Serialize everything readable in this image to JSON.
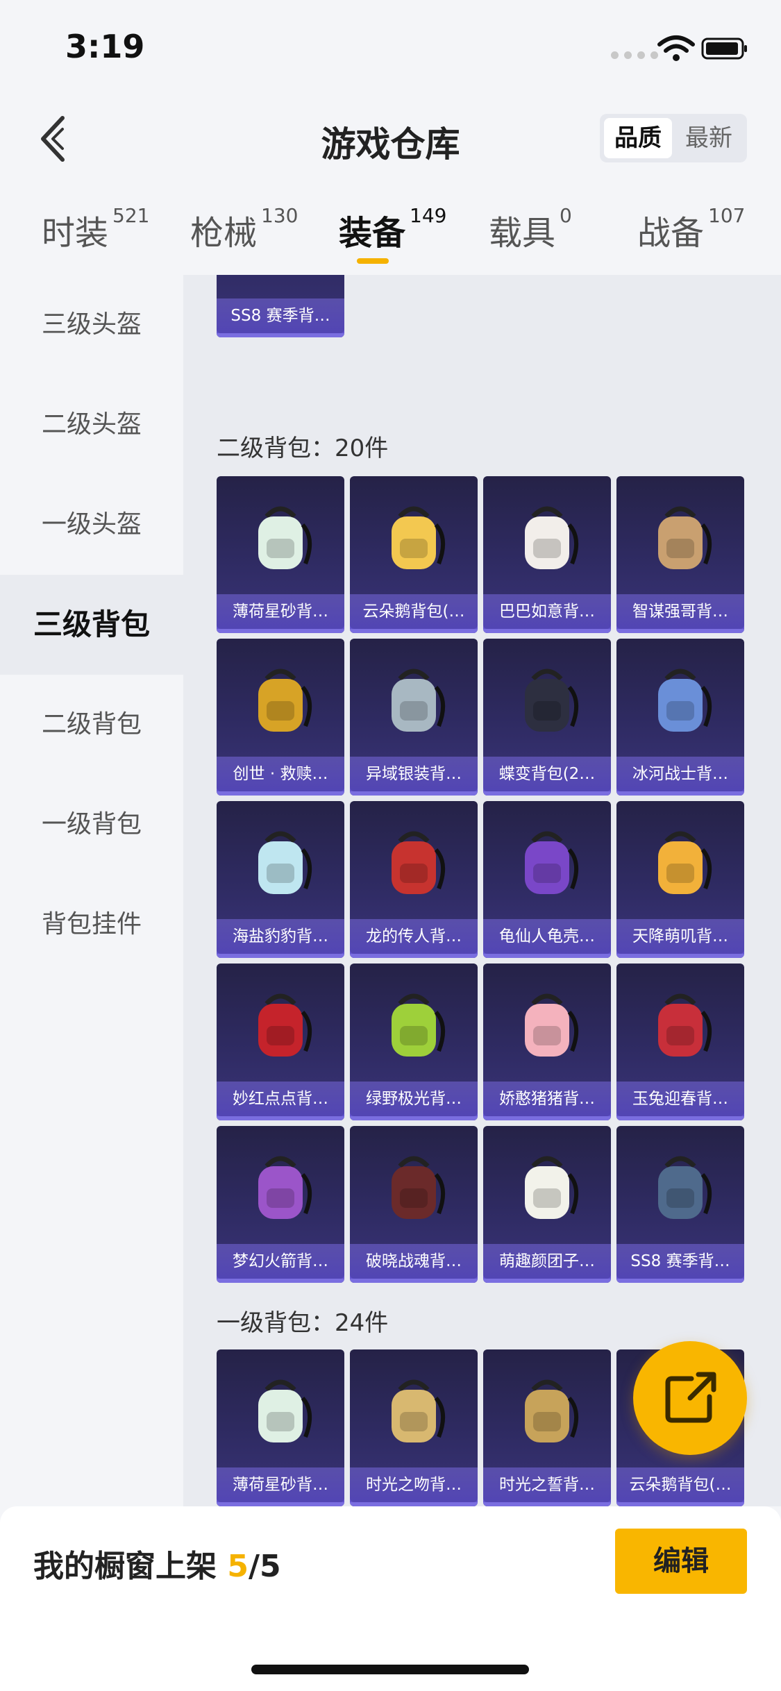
{
  "status_bar": {
    "time": "3:19"
  },
  "header": {
    "title": "游戏仓库",
    "sort_quality": "品质",
    "sort_newest": "最新"
  },
  "tabs": [
    {
      "label": "时装",
      "count": "521"
    },
    {
      "label": "枪械",
      "count": "130"
    },
    {
      "label": "装备",
      "count": "149"
    },
    {
      "label": "载具",
      "count": "0"
    },
    {
      "label": "战备",
      "count": "107"
    }
  ],
  "sidebar": {
    "items": [
      {
        "label": "三级头盔"
      },
      {
        "label": "二级头盔"
      },
      {
        "label": "一级头盔"
      },
      {
        "label": "三级背包"
      },
      {
        "label": "二级背包"
      },
      {
        "label": "一级背包"
      },
      {
        "label": "背包挂件"
      }
    ]
  },
  "sections": [
    {
      "items": [
        {
          "name": "SS8 赛季背…",
          "color": "#3a4a6a"
        }
      ]
    },
    {
      "title": "二级背包：20件",
      "items": [
        {
          "name": "薄荷星砂背…",
          "color": "#dff0e4"
        },
        {
          "name": "云朵鹅背包(…",
          "color": "#f3c850"
        },
        {
          "name": "巴巴如意背…",
          "color": "#f2eeea"
        },
        {
          "name": "智谋强哥背…",
          "color": "#c9a070"
        },
        {
          "name": "创世 · 救赎…",
          "color": "#d7a326"
        },
        {
          "name": "异域银装背…",
          "color": "#a8b8c2"
        },
        {
          "name": "蝶变背包(2…",
          "color": "#2d2f40"
        },
        {
          "name": "冰河战士背…",
          "color": "#6a8fd8"
        },
        {
          "name": "海盐豹豹背…",
          "color": "#bfe6f0"
        },
        {
          "name": "龙的传人背…",
          "color": "#c7332f"
        },
        {
          "name": "龟仙人龟壳…",
          "color": "#7a47c8"
        },
        {
          "name": "天降萌叽背…",
          "color": "#f2b13a"
        },
        {
          "name": "妙红点点背…",
          "color": "#c5232b"
        },
        {
          "name": "绿野极光背…",
          "color": "#9ed03a"
        },
        {
          "name": "娇憨猪猪背…",
          "color": "#f4b2bd"
        },
        {
          "name": "玉兔迎春背…",
          "color": "#c82f3a"
        },
        {
          "name": "梦幻火箭背…",
          "color": "#9b55c9"
        },
        {
          "name": "破晓战魂背…",
          "color": "#6b2a2a"
        },
        {
          "name": "萌趣颜团子…",
          "color": "#f2f2ea"
        },
        {
          "name": "SS8 赛季背…",
          "color": "#4f6a8c"
        }
      ]
    },
    {
      "title": "一级背包：24件",
      "items": [
        {
          "name": "薄荷星砂背…",
          "color": "#dff0e4"
        },
        {
          "name": "时光之吻背…",
          "color": "#d8b870"
        },
        {
          "name": "时光之誓背…",
          "color": "#c7a35a"
        },
        {
          "name": "云朵鹅背包(…",
          "color": "#f3c850"
        }
      ]
    }
  ],
  "bottom_bar": {
    "shelf_label": "我的橱窗上架",
    "shelf_count": "5",
    "shelf_total": "/5",
    "edit_label": "编辑"
  },
  "colors": {
    "accent": "#f9b600",
    "card_bg": "#2f2b63"
  },
  "icons": [
    "back-icon",
    "wifi-icon",
    "battery-icon",
    "share-icon"
  ]
}
